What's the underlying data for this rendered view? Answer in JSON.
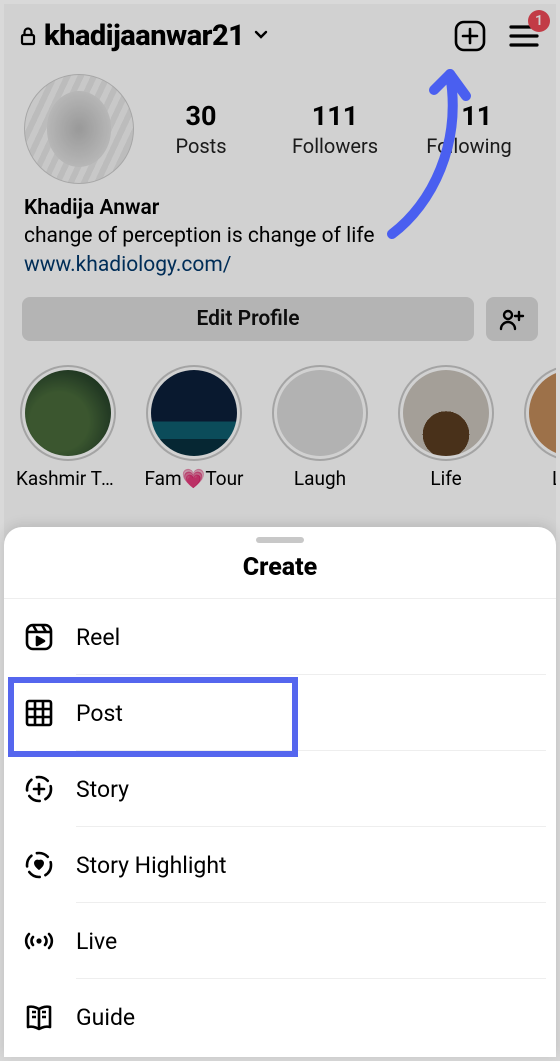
{
  "topbar": {
    "username": "khadijaanwar21",
    "badge_count": "1"
  },
  "stats": {
    "posts": {
      "num": "30",
      "lbl": "Posts"
    },
    "followers": {
      "num": "111",
      "lbl": "Followers"
    },
    "following": {
      "num": "111",
      "lbl": "Following"
    }
  },
  "bio": {
    "name": "Khadija Anwar",
    "text": "change of perception is change of life",
    "link": "www.khadiology.com/"
  },
  "edit_profile_label": "Edit Profile",
  "highlights": [
    {
      "label": "Kashmir Tou…"
    },
    {
      "label": "Fam💗Tour"
    },
    {
      "label": "Laugh"
    },
    {
      "label": "Life"
    },
    {
      "label": "Love"
    }
  ],
  "sheet": {
    "title": "Create",
    "options": [
      {
        "label": "Reel"
      },
      {
        "label": "Post"
      },
      {
        "label": "Story"
      },
      {
        "label": "Story Highlight"
      },
      {
        "label": "Live"
      },
      {
        "label": "Guide"
      }
    ]
  }
}
